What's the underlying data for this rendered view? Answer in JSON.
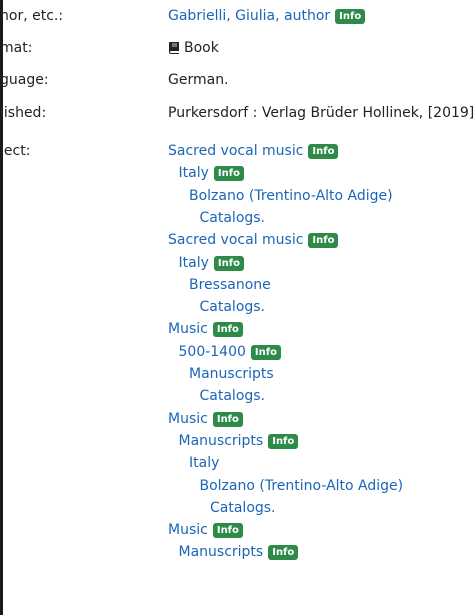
{
  "fields": {
    "author_label": "hor, etc.:",
    "author_value": "Gabrielli, Giulia, author",
    "format_label": "mat:",
    "format_value": "Book",
    "language_label": "guage:",
    "language_value": "German.",
    "published_label": "lished:",
    "published_value": "Purkersdorf : Verlag Brüder Hollinek, [2019]",
    "subject_label": "ject:"
  },
  "info_label": "Info",
  "icons": {
    "format": "book-icon"
  },
  "colors": {
    "link": "#1a66b8",
    "info_badge": "#2e8a49"
  },
  "subjects": [
    {
      "text": "Sacred vocal music",
      "level": 0,
      "info": true
    },
    {
      "text": "Italy",
      "level": 1,
      "info": true
    },
    {
      "text": "Bolzano (Trentino-Alto Adige)",
      "level": 2,
      "info": false
    },
    {
      "text": "Catalogs.",
      "level": 3,
      "info": false
    },
    {
      "text": "Sacred vocal music",
      "level": 0,
      "info": true
    },
    {
      "text": "Italy",
      "level": 1,
      "info": true
    },
    {
      "text": "Bressanone",
      "level": 2,
      "info": false
    },
    {
      "text": "Catalogs.",
      "level": 3,
      "info": false
    },
    {
      "text": "Music",
      "level": 0,
      "info": true
    },
    {
      "text": "500-1400",
      "level": 1,
      "info": true
    },
    {
      "text": "Manuscripts",
      "level": 2,
      "info": false
    },
    {
      "text": "Catalogs.",
      "level": 3,
      "info": false
    },
    {
      "text": "Music",
      "level": 0,
      "info": true
    },
    {
      "text": "Manuscripts",
      "level": 1,
      "info": true
    },
    {
      "text": "Italy",
      "level": 2,
      "info": false
    },
    {
      "text": "Bolzano (Trentino-Alto Adige)",
      "level": 3,
      "info": false
    },
    {
      "text": "Catalogs.",
      "level": 4,
      "info": false
    },
    {
      "text": "Music",
      "level": 0,
      "info": true
    },
    {
      "text": "Manuscripts",
      "level": 1,
      "info": true
    }
  ]
}
